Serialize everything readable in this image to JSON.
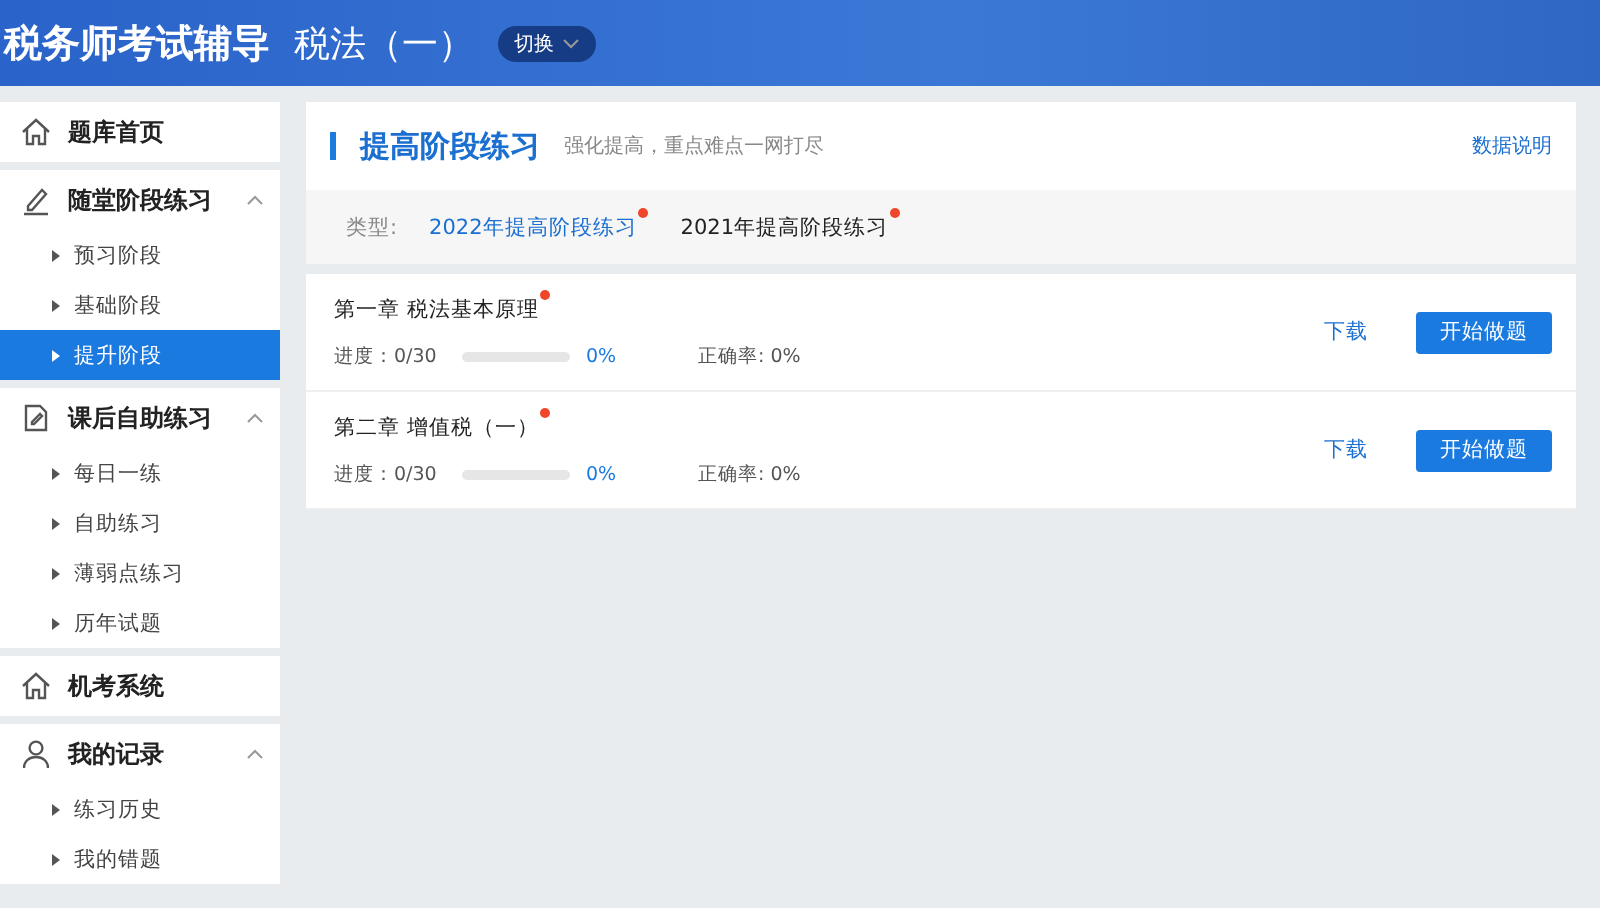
{
  "header": {
    "title": "税务师考试辅导",
    "subject": "税法（一）",
    "switch_button": "切换"
  },
  "sidebar": {
    "groups": [
      {
        "label": "题库首页"
      },
      {
        "label": "随堂阶段练习",
        "expanded": true,
        "children": [
          {
            "label": "预习阶段",
            "selected": false
          },
          {
            "label": "基础阶段",
            "selected": false
          },
          {
            "label": "提升阶段",
            "selected": true
          }
        ]
      },
      {
        "label": "课后自助练习",
        "expanded": true,
        "children": [
          {
            "label": "每日一练",
            "selected": false
          },
          {
            "label": "自助练习",
            "selected": false
          },
          {
            "label": "薄弱点练习",
            "selected": false
          },
          {
            "label": "历年试题",
            "selected": false
          }
        ]
      },
      {
        "label": "机考系统"
      },
      {
        "label": "我的记录",
        "expanded": true,
        "children": [
          {
            "label": "练习历史",
            "selected": false
          },
          {
            "label": "我的错题",
            "selected": false
          }
        ]
      }
    ]
  },
  "panel": {
    "title": "提高阶段练习",
    "subtitle": "强化提高，重点难点一网打尽",
    "help_link": "数据说明",
    "type_label": "类型:",
    "types": [
      {
        "label": "2022年提高阶段练习",
        "selected": true,
        "badge": true
      },
      {
        "label": "2021年提高阶段练习",
        "selected": false,
        "badge": true
      }
    ]
  },
  "chapters": [
    {
      "title": "第一章 税法基本原理",
      "badge": true,
      "progress_label": "进度：0/30",
      "level": 0,
      "percent": "0%",
      "accuracy": "正确率: 0%",
      "download": "下载",
      "start": "开始做题"
    },
    {
      "title": "第二章 增值税（一）",
      "badge": true,
      "progress_label": "进度：0/30",
      "level": 0,
      "percent": "0%",
      "accuracy": "正确率: 0%",
      "download": "下载",
      "start": "开始做题"
    }
  ]
}
